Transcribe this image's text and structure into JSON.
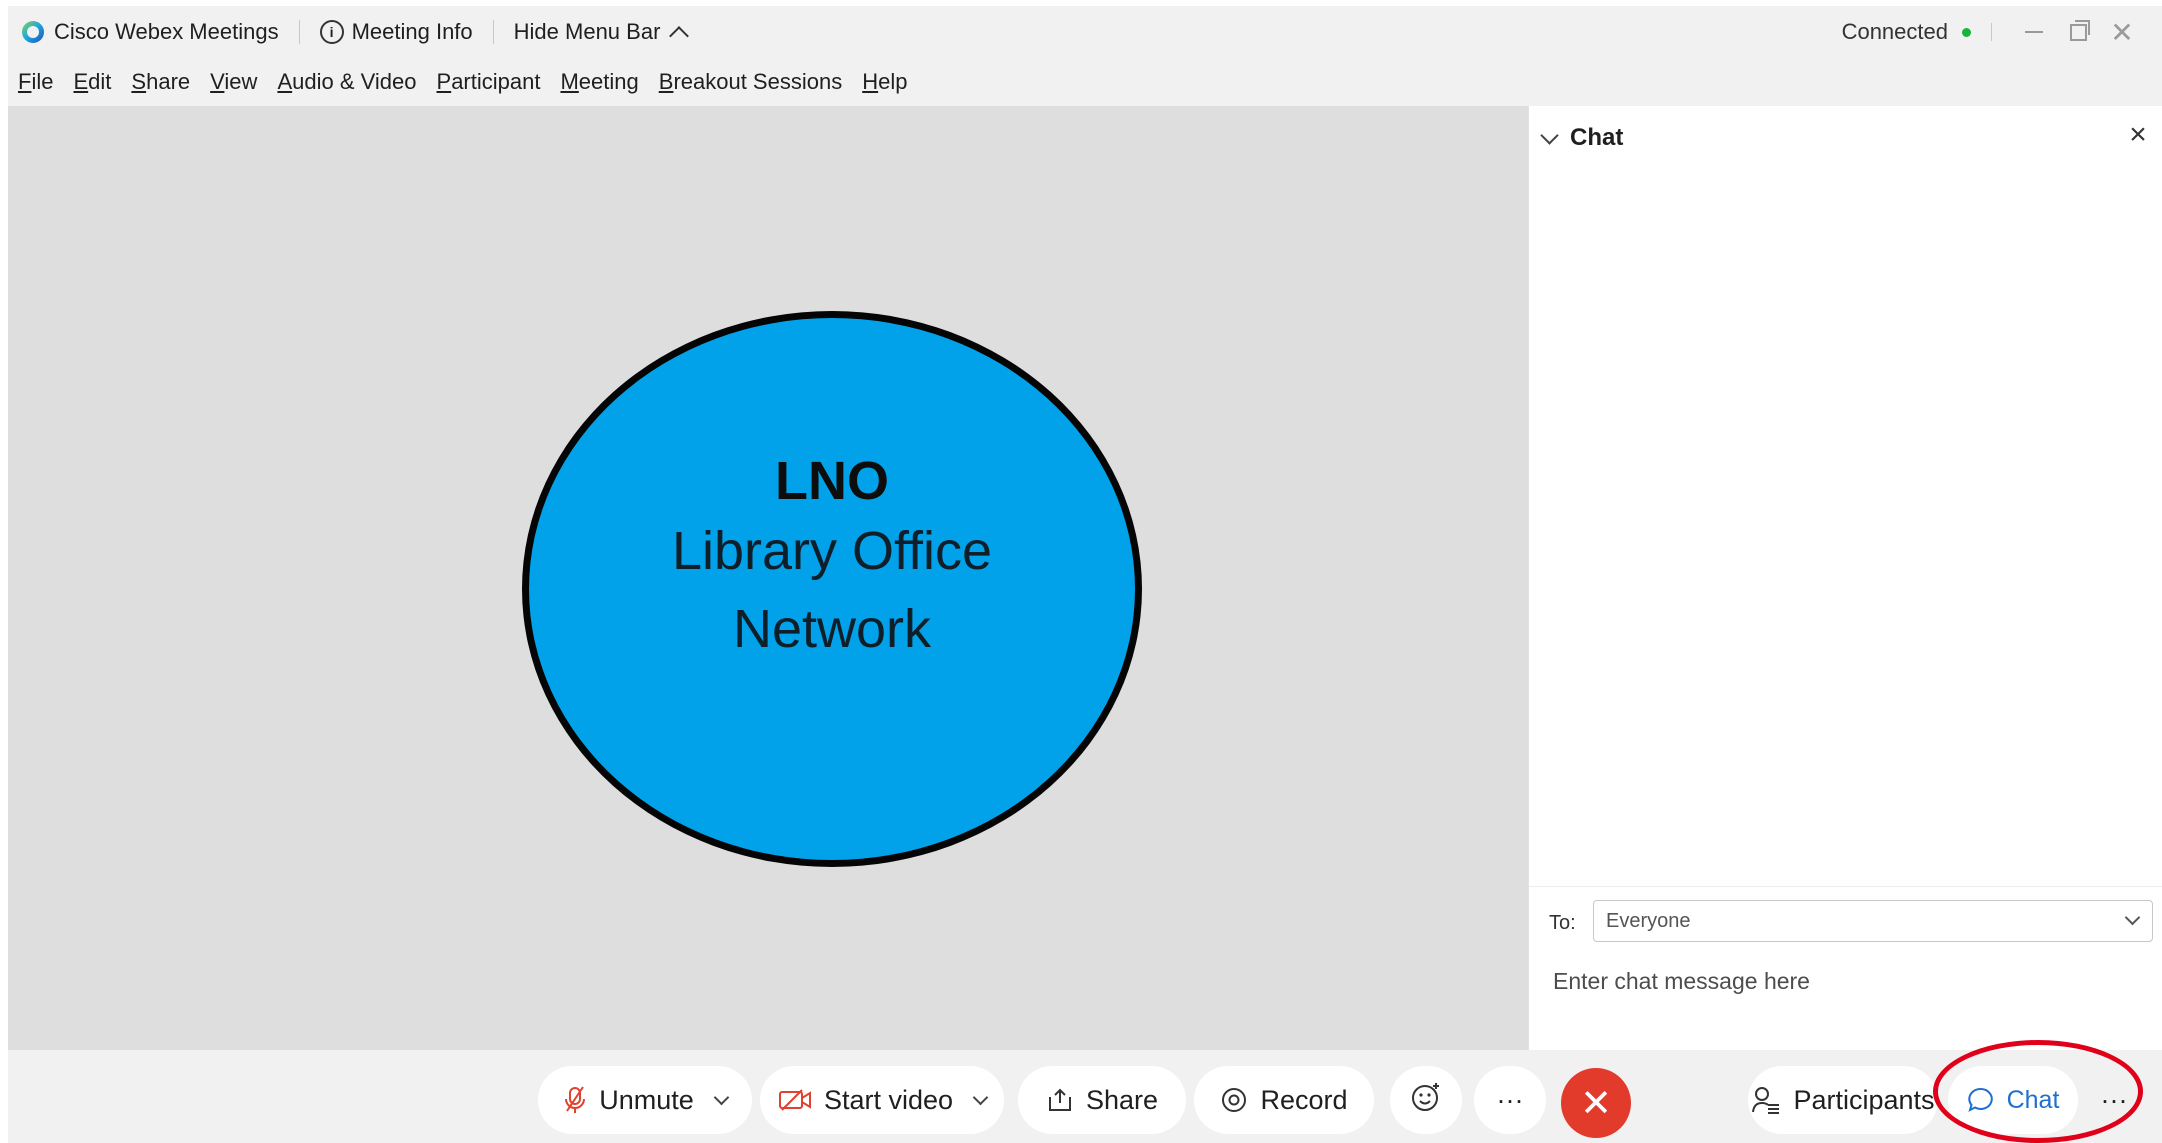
{
  "titlebar": {
    "app_name": "Cisco Webex Meetings",
    "meeting_info": "Meeting Info",
    "hide_menu_bar": "Hide Menu Bar",
    "status": "Connected",
    "status_color": "#18b33a"
  },
  "menubar": {
    "items": [
      {
        "mnemonic": "F",
        "rest": "ile"
      },
      {
        "mnemonic": "E",
        "rest": "dit"
      },
      {
        "mnemonic": "S",
        "rest": "hare"
      },
      {
        "mnemonic": "V",
        "rest": "iew"
      },
      {
        "mnemonic": "A",
        "rest": "udio & Video"
      },
      {
        "mnemonic": "P",
        "rest": "articipant"
      },
      {
        "mnemonic": "M",
        "rest": "eeting"
      },
      {
        "mnemonic": "B",
        "rest": "reakout Sessions"
      },
      {
        "mnemonic": "H",
        "rest": "elp"
      }
    ]
  },
  "stage": {
    "avatar_abbr": "LNO",
    "avatar_name_line1": "Library Office",
    "avatar_name_line2": "Network",
    "avatar_color": "#01a2ea"
  },
  "chat": {
    "title": "Chat",
    "to_label": "To:",
    "recipient": "Everyone",
    "input_placeholder": "Enter chat message here"
  },
  "controls": {
    "unmute": "Unmute",
    "start_video": "Start video",
    "share": "Share",
    "record": "Record",
    "more_ellipsis": "···",
    "participants": "Participants",
    "chat": "Chat",
    "overflow": "···",
    "end_color": "#e23a2b",
    "highlight_color": "#e0001a"
  }
}
